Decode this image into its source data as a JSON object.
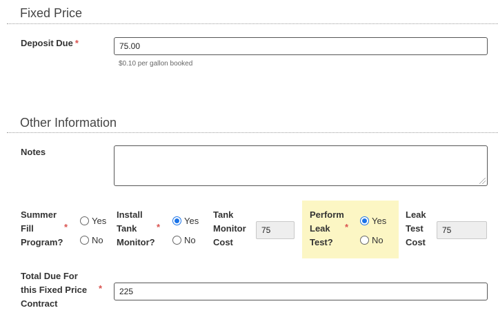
{
  "fixed_price": {
    "title": "Fixed Price",
    "deposit_label": "Deposit Due",
    "required_mark": "*",
    "deposit_value": "75.00",
    "deposit_help": "$0.10 per gallon booked"
  },
  "other_info": {
    "title": "Other Information",
    "notes_label": "Notes",
    "notes_value": "",
    "summer_fill": {
      "label_lines": [
        "Summer",
        "Fill",
        "Program?"
      ],
      "required_mark": "*",
      "options": [
        {
          "label": "Yes",
          "selected": false
        },
        {
          "label": "No",
          "selected": false
        }
      ]
    },
    "install_tank_monitor": {
      "label_lines": [
        "Install",
        "Tank",
        "Monitor?"
      ],
      "required_mark": "*",
      "options": [
        {
          "label": "Yes",
          "selected": true
        },
        {
          "label": "No",
          "selected": false
        }
      ]
    },
    "tank_monitor_cost": {
      "label_lines": [
        "Tank",
        "Monitor",
        "Cost"
      ],
      "value": "75"
    },
    "perform_leak_test": {
      "label_lines": [
        "Perform",
        "Leak",
        "Test?"
      ],
      "required_mark": "*",
      "options": [
        {
          "label": "Yes",
          "selected": true
        },
        {
          "label": "No",
          "selected": false
        }
      ]
    },
    "leak_test_cost": {
      "label_lines": [
        "Leak",
        "Test",
        "Cost"
      ],
      "value": "75"
    },
    "total_due": {
      "label_lines": [
        "Total Due For",
        "this Fixed Price",
        "Contract"
      ],
      "required_mark": "*",
      "value": "225"
    }
  },
  "colors": {
    "required": "#d9534f",
    "highlight": "#fcf6c4",
    "radio_selected": "#1a73e8"
  }
}
